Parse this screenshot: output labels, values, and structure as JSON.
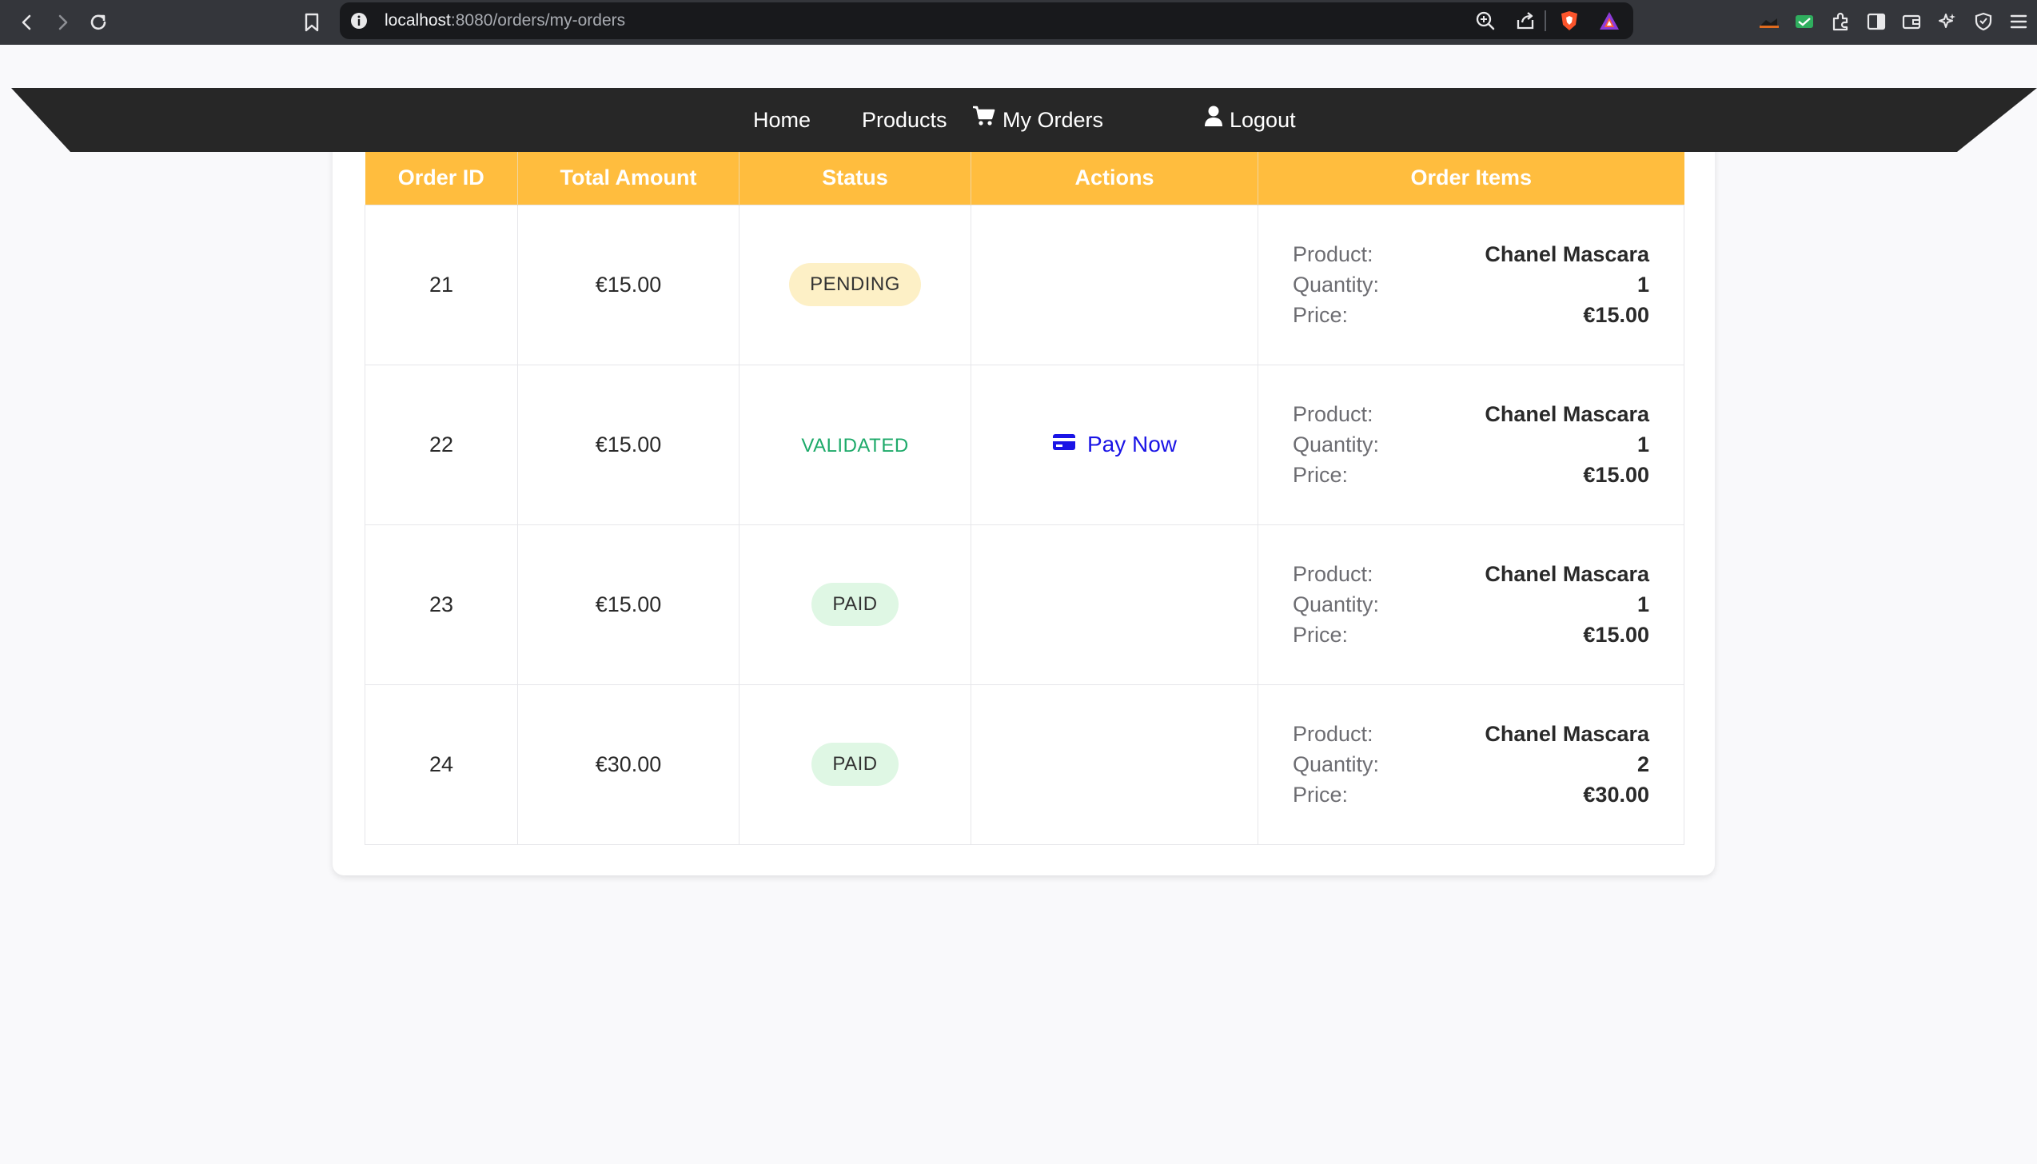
{
  "browser": {
    "url_host": "localhost",
    "url_path": ":8080/orders/my-orders"
  },
  "nav": {
    "home": "Home",
    "products": "Products",
    "my_orders": "My Orders",
    "logout": "Logout"
  },
  "table": {
    "headers": [
      "Order ID",
      "Total Amount",
      "Status",
      "Actions",
      "Order Items"
    ],
    "item_labels": {
      "product": "Product:",
      "quantity": "Quantity:",
      "price": "Price:"
    },
    "pay_label": "Pay Now",
    "rows": [
      {
        "id": "21",
        "total": "€15.00",
        "status": "PENDING",
        "product": "Chanel Mascara",
        "quantity": "1",
        "price": "€15.00"
      },
      {
        "id": "22",
        "total": "€15.00",
        "status": "VALIDATED",
        "product": "Chanel Mascara",
        "quantity": "1",
        "price": "€15.00"
      },
      {
        "id": "23",
        "total": "€15.00",
        "status": "PAID",
        "product": "Chanel Mascara",
        "quantity": "1",
        "price": "€15.00"
      },
      {
        "id": "24",
        "total": "€30.00",
        "status": "PAID",
        "product": "Chanel Mascara",
        "quantity": "2",
        "price": "€30.00"
      }
    ]
  },
  "colors": {
    "header_bg": "#ffbd3e",
    "nav_bg": "#272727",
    "pending_bg": "#fdf0c6",
    "paid_bg": "#dff7e4",
    "validated_text": "#1eaa6a",
    "pay_link": "#1a14e6"
  }
}
